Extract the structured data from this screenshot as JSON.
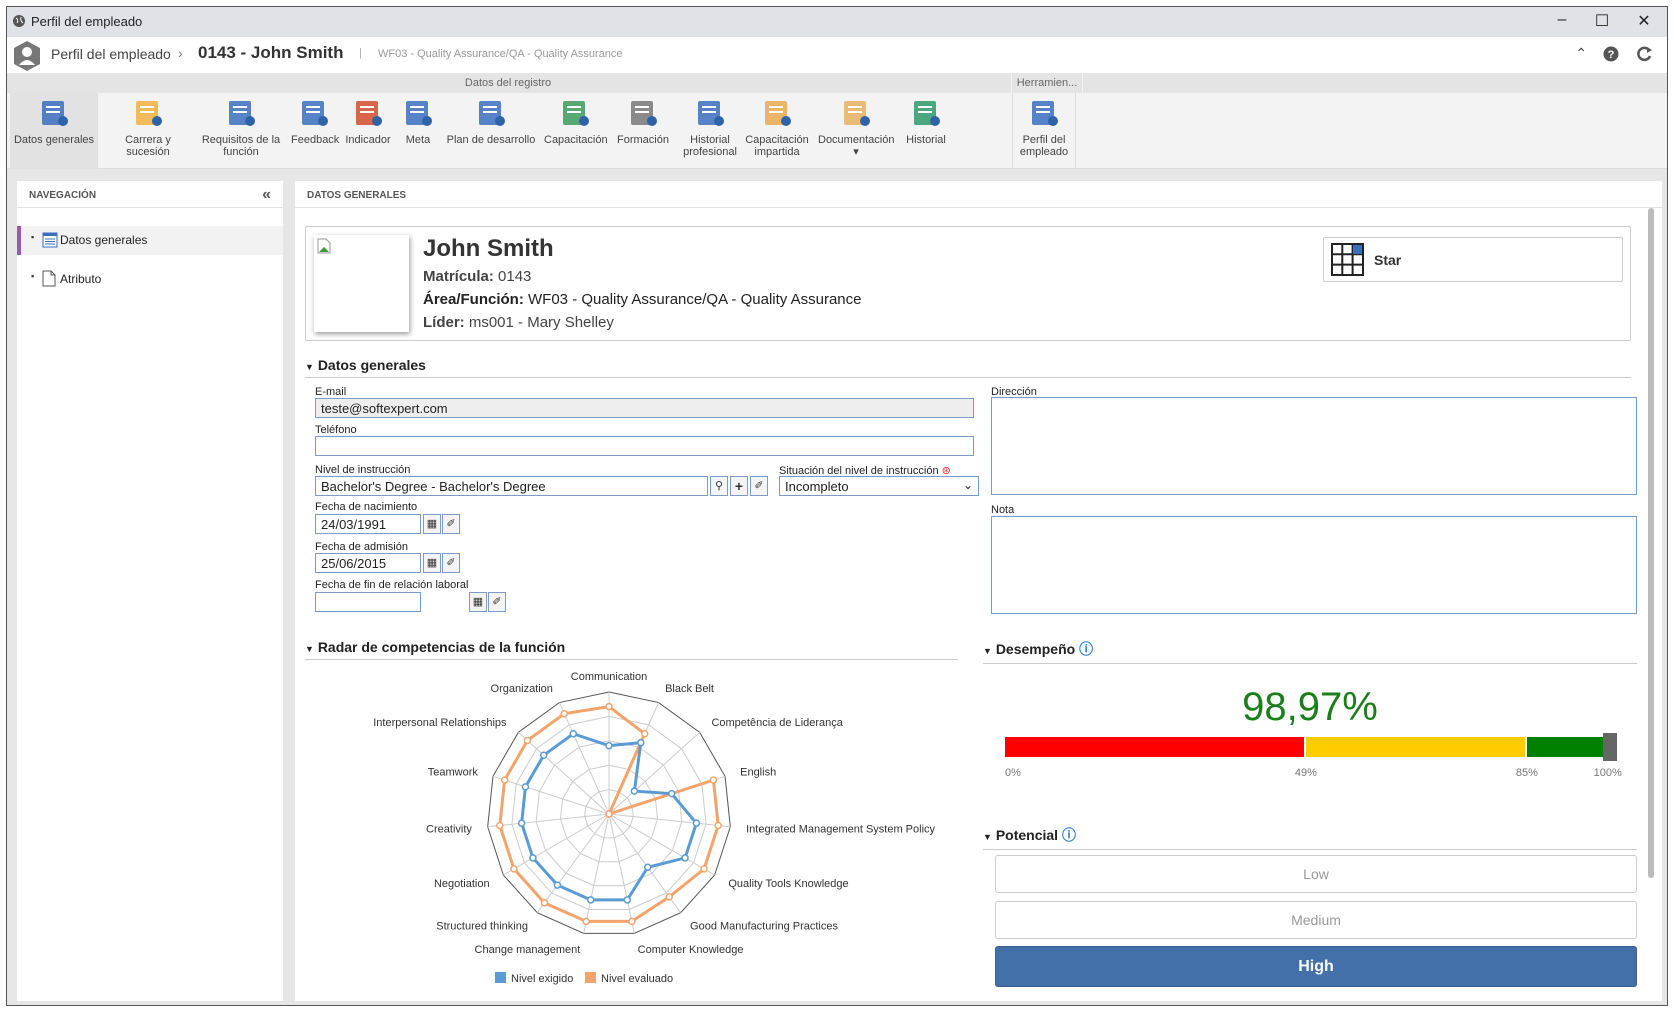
{
  "window": {
    "title": "Perfil del empleado",
    "minimize": "–",
    "maximize": "☐",
    "close": "✕"
  },
  "breadcrumb": {
    "root": "Perfil del empleado",
    "separator": "›",
    "current": "0143 - John Smith",
    "divider": "|",
    "subtitle": "WF03 - Quality Assurance/QA - Quality Assurance"
  },
  "ribbon": {
    "group1": "Datos del registro",
    "group2": "Herramien...",
    "buttons": [
      {
        "label": "Datos generales",
        "icon": "list-icon"
      },
      {
        "label": "Carrera y sucesión",
        "icon": "star-info-icon"
      },
      {
        "label": "Requisitos de la función",
        "icon": "org-chart-icon"
      },
      {
        "label": "Feedback",
        "icon": "feedback-icon"
      },
      {
        "label": "Indicador",
        "icon": "gauge-icon"
      },
      {
        "label": "Meta",
        "icon": "target-icon"
      },
      {
        "label": "Plan de desarrollo",
        "icon": "gantt-icon"
      },
      {
        "label": "Capacitación",
        "icon": "certificate-icon"
      },
      {
        "label": "Formación",
        "icon": "institution-icon"
      },
      {
        "label": "Historial profesional",
        "icon": "binders-icon"
      },
      {
        "label": "Capacitación impartida",
        "icon": "briefcase-icon"
      },
      {
        "label": "Documentación",
        "icon": "folder-clip-icon",
        "dropdown": "▾"
      },
      {
        "label": "Historial",
        "icon": "history-icon"
      },
      {
        "label": "Perfil del empleado",
        "icon": "printer-icon"
      }
    ]
  },
  "nav": {
    "title": "NAVEGACIÓN",
    "collapse": "«",
    "items": [
      {
        "label": "Datos generales",
        "active": true
      },
      {
        "label": "Atributo"
      }
    ]
  },
  "main": {
    "title": "DATOS GENERALES"
  },
  "profile": {
    "name": "John Smith",
    "matricula_label": "Matrícula:",
    "matricula": "0143",
    "area_label": "Área/Función:",
    "area": "WF03 - Quality Assurance/QA - Quality Assurance",
    "lider_label": "Líder:",
    "lider": "ms001 - Mary Shelley",
    "badge": "Star"
  },
  "general": {
    "title": "Datos generales",
    "email_label": "E-mail",
    "email": "teste@softexpert.com",
    "phone_label": "Teléfono",
    "phone": "",
    "education_label": "Nivel de instrucción",
    "education": "Bachelor's Degree - Bachelor's Degree",
    "status_label": "Situación del nivel de instrucción",
    "status": "Incompleto",
    "birth_label": "Fecha de nacimiento",
    "birth": "24/03/1991",
    "admission_label": "Fecha de admisión",
    "admission": "25/06/2015",
    "end_label": "Fecha de fin de relación laboral",
    "end": "",
    "address_label": "Dirección",
    "note_label": "Nota"
  },
  "radar": {
    "title": "Radar de competencias de la función"
  },
  "performance": {
    "title": "Desempeño",
    "value": "98,97%",
    "value_pct": 98.97,
    "ticks": [
      "0%",
      "49%",
      "85%",
      "100%"
    ],
    "colors": {
      "low": "#ff0000",
      "mid": "#ffcc00",
      "high": "#008000",
      "value": "#1a7f1a"
    }
  },
  "potential": {
    "title": "Potencial",
    "options": [
      "Low",
      "Medium",
      "High"
    ],
    "selected": "High",
    "accent": "#4470aa"
  },
  "chart_data": {
    "type": "radar",
    "rlim": [
      0,
      5
    ],
    "grid": true,
    "legend": "bottom",
    "categories": [
      "Communication",
      "Black Belt",
      "Competência de Liderança",
      "English",
      "Integrated Management System Policy",
      "Quality Tools Knowledge",
      "Good Manufacturing Practices",
      "Computer Knowledge",
      "Change management",
      "Structured thinking",
      "Negotiation",
      "Creativity",
      "Teamwork",
      "Interpersonal Relationships",
      "Organization"
    ],
    "series": [
      {
        "name": "Nivel exigido",
        "color": "#5b9bd5",
        "values": [
          2.8,
          3.2,
          1.4,
          2.7,
          3.6,
          3.6,
          2.7,
          3.6,
          3.6,
          3.6,
          3.6,
          3.6,
          3.6,
          3.6,
          3.6
        ]
      },
      {
        "name": "Nivel evaluado",
        "color": "#f4a46a",
        "values": [
          4.4,
          3.6,
          0,
          4.5,
          4.5,
          4.5,
          4.2,
          4.5,
          4.5,
          4.5,
          4.5,
          4.5,
          4.5,
          4.5,
          4.5
        ]
      }
    ]
  }
}
